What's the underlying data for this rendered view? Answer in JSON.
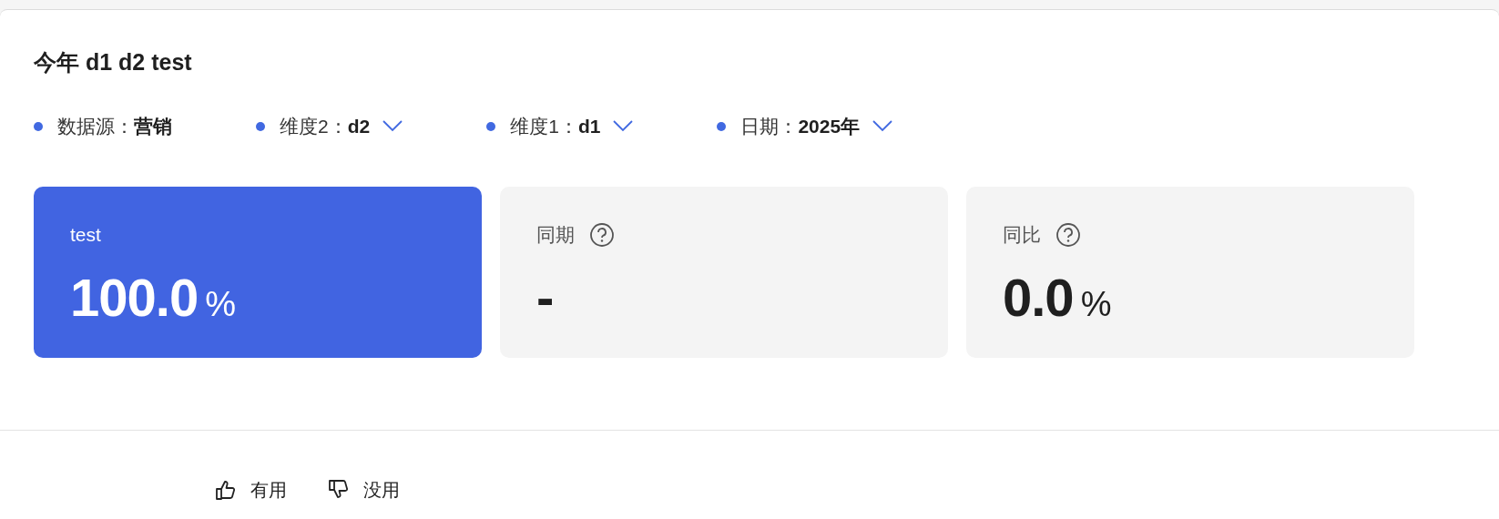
{
  "title": "今年 d1 d2 test",
  "filters": [
    {
      "label": "数据源：",
      "value": "营销",
      "dropdown": false
    },
    {
      "label": "维度2：",
      "value": "d2",
      "dropdown": true
    },
    {
      "label": "维度1：",
      "value": "d1",
      "dropdown": true
    },
    {
      "label": "日期：",
      "value": "2025年",
      "dropdown": true
    }
  ],
  "metrics": [
    {
      "label": "test",
      "value": "100.0",
      "unit": "%",
      "highlighted": true,
      "help": false
    },
    {
      "label": "同期",
      "value": "-",
      "highlighted": false,
      "help": true
    },
    {
      "label": "同比",
      "value": "0.0",
      "unit": "%",
      "highlighted": false,
      "help": true
    }
  ],
  "feedback": [
    {
      "kind": "up",
      "label": "有用"
    },
    {
      "kind": "down",
      "label": "没用"
    }
  ]
}
